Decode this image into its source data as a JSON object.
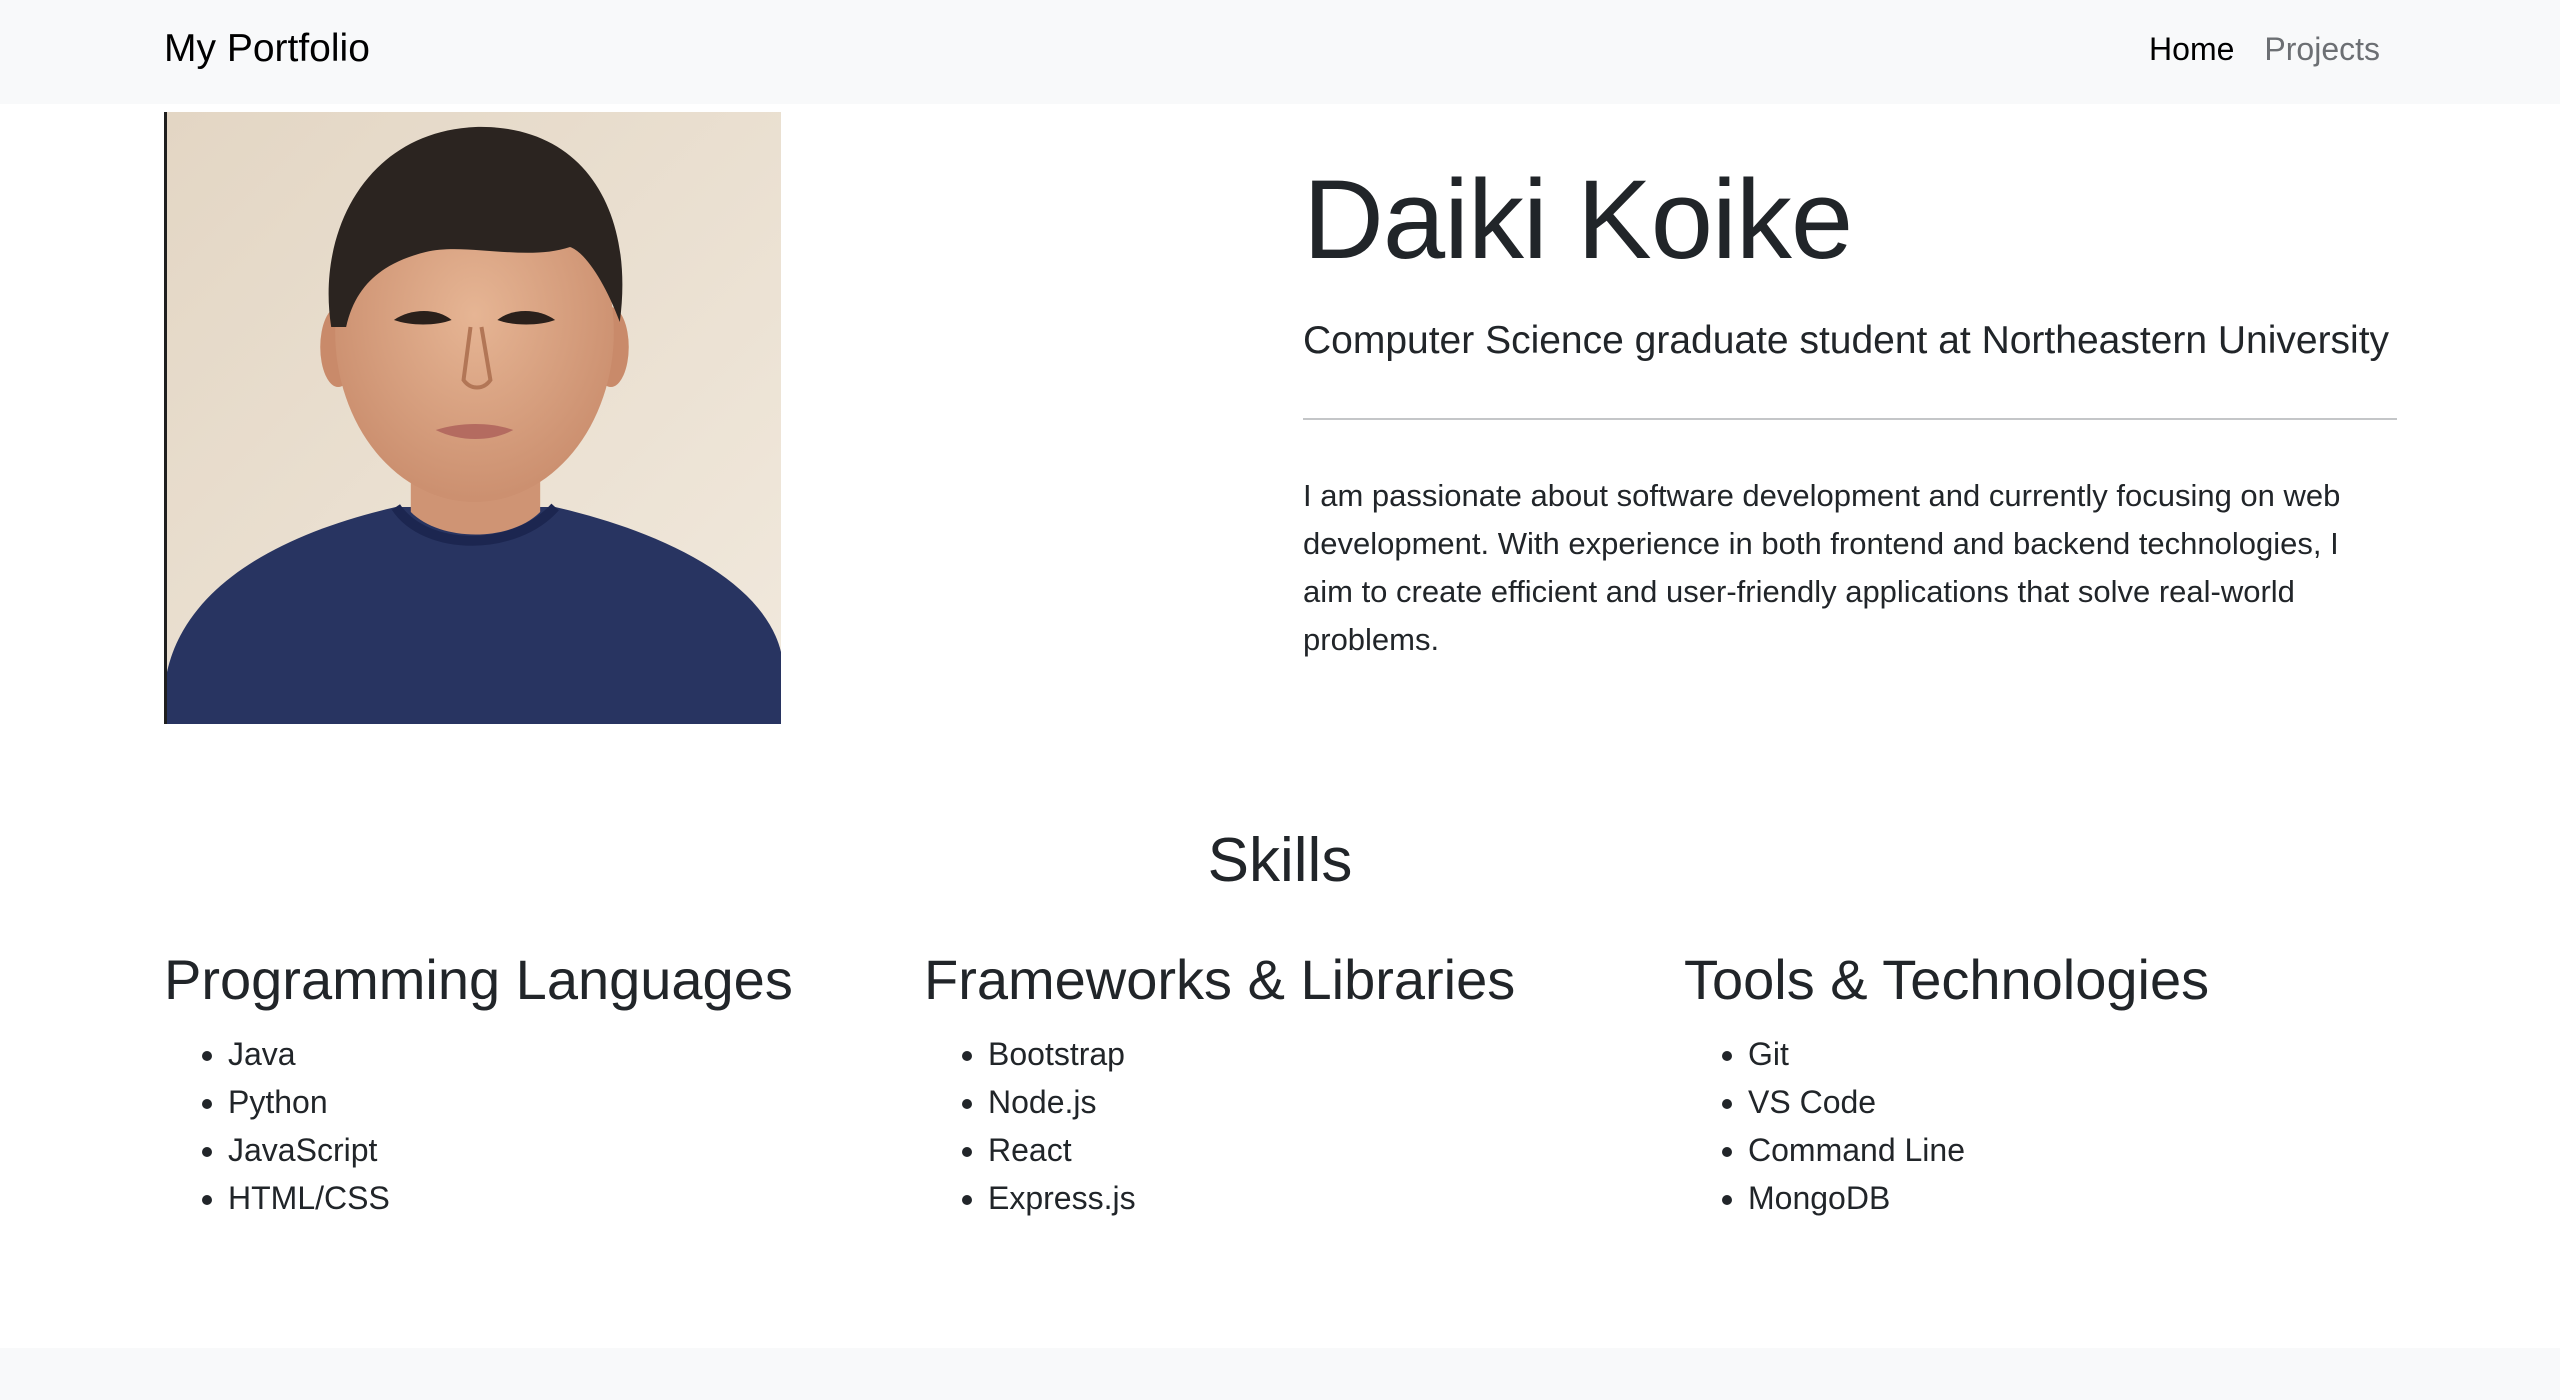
{
  "nav": {
    "brand": "My Portfolio",
    "links": [
      {
        "label": "Home",
        "active": true
      },
      {
        "label": "Projects",
        "active": false
      }
    ]
  },
  "profile": {
    "name": "Daiki Koike",
    "subtitle": "Computer Science graduate student at Northeastern University",
    "bio": "I am passionate about software development and currently focusing on web development. With experience in both frontend and backend technologies, I aim to create efficient and user-friendly applications that solve real-world problems."
  },
  "skills": {
    "title": "Skills",
    "categories": [
      {
        "title": "Programming Languages",
        "items": [
          "Java",
          "Python",
          "JavaScript",
          "HTML/CSS"
        ]
      },
      {
        "title": "Frameworks & Libraries",
        "items": [
          "Bootstrap",
          "Node.js",
          "React",
          "Express.js"
        ]
      },
      {
        "title": "Tools & Technologies",
        "items": [
          "Git",
          "VS Code",
          "Command Line",
          "MongoDB"
        ]
      }
    ]
  },
  "colors": {
    "navbar_bg": "#f8f9fa",
    "text": "#212529",
    "nav_inactive": "#6c6f73",
    "divider": "#c4c6c8"
  }
}
